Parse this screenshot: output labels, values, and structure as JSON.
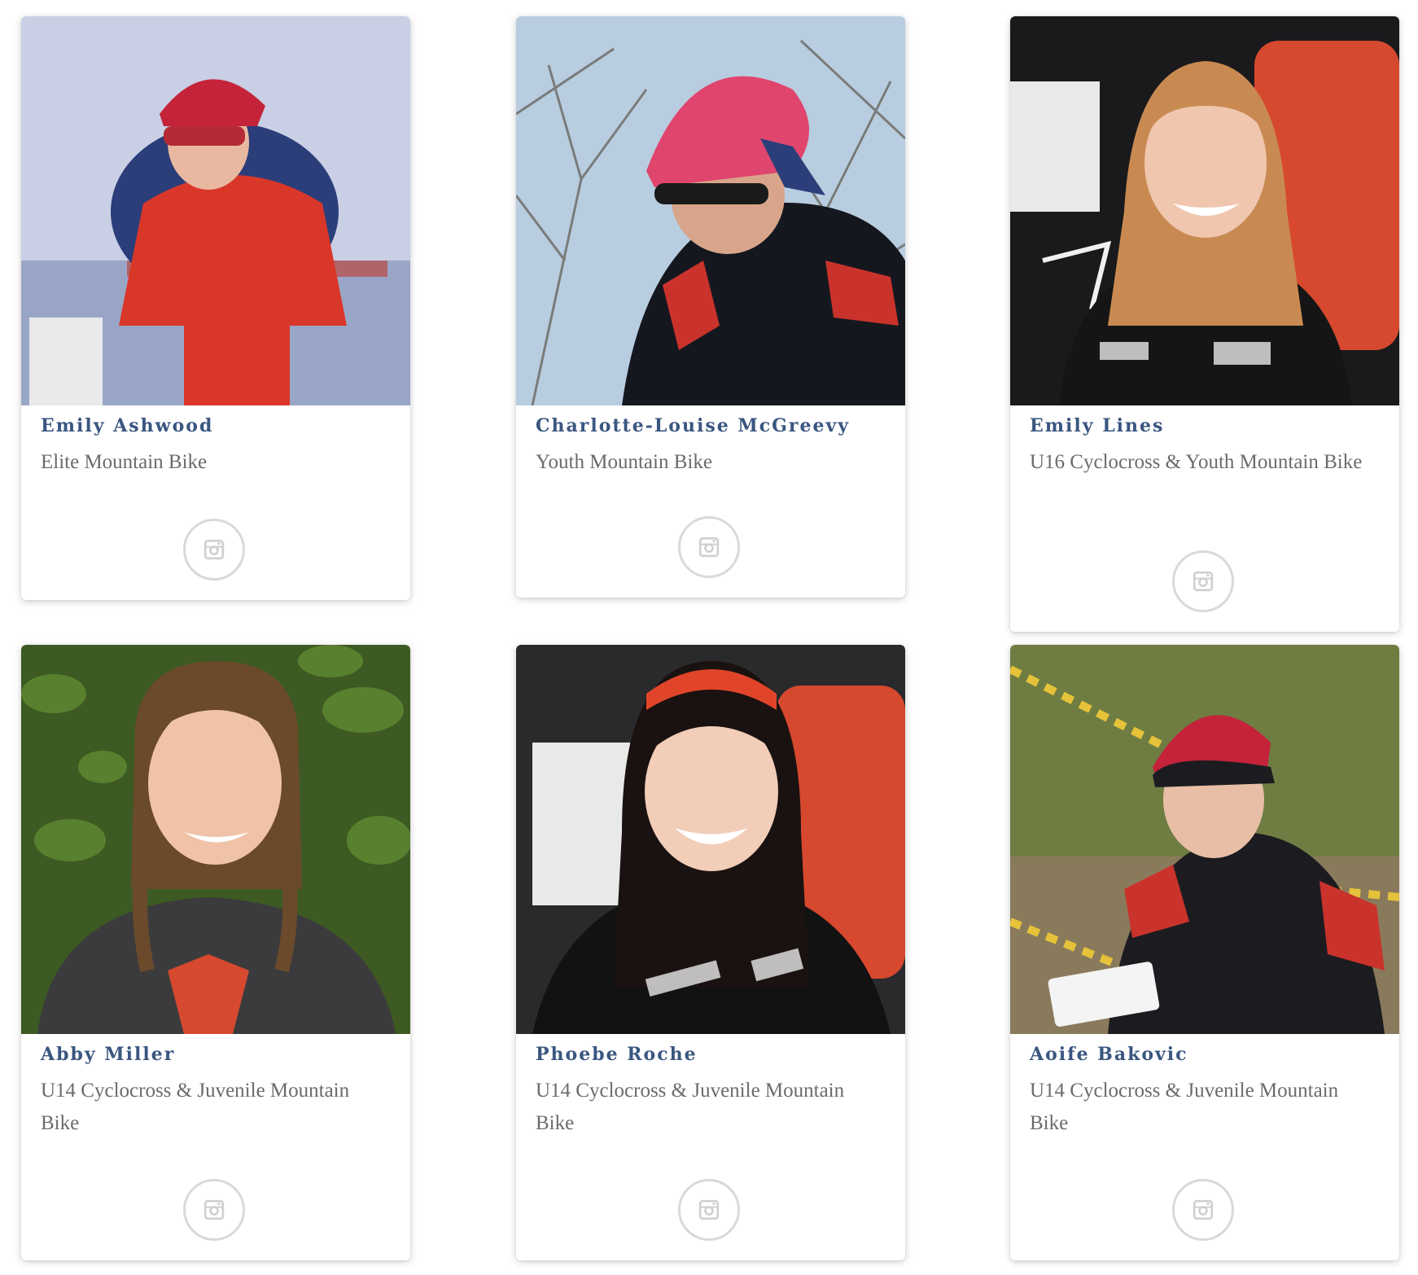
{
  "riders": [
    {
      "name": "Emily Ashwood",
      "role": "Elite Mountain Bike",
      "social_icon": "instagram-icon",
      "photo_palette": {
        "sky": "#c9cfe4",
        "kit": "#d9372a",
        "kit2": "#2b3e7a",
        "helmet": "#c4233a",
        "skin": "#e8b9a0",
        "bg": "#9aa6c7"
      }
    },
    {
      "name": "Charlotte-Louise McGreevy",
      "role": "Youth Mountain Bike",
      "social_icon": "instagram-icon",
      "photo_palette": {
        "sky": "#b9cde0",
        "kit": "#15171f",
        "kit2": "#c9332b",
        "helmet": "#e0456e",
        "skin": "#d8a58a",
        "bg": "#8a8b86"
      }
    },
    {
      "name": "Emily Lines",
      "role": "U16 Cyclocross & Youth Mountain Bike",
      "social_icon": "instagram-icon",
      "photo_palette": {
        "sky": "#1a1a1c",
        "kit": "#151515",
        "kit2": "#d6492f",
        "helmet": "#c98a52",
        "skin": "#f0c6ae",
        "bg": "#2a2a2c"
      }
    },
    {
      "name": "Abby Miller",
      "role": "U14 Cyclocross & Juvenile Mountain Bike",
      "social_icon": "instagram-icon",
      "photo_palette": {
        "sky": "#2f4a1c",
        "kit": "#3b3b3d",
        "kit2": "#d6492f",
        "helmet": "#6b4a2c",
        "skin": "#f0c3a8",
        "bg": "#3d5a22"
      }
    },
    {
      "name": "Phoebe Roche",
      "role": "U14 Cyclocross & Juvenile Mountain Bike",
      "social_icon": "instagram-icon",
      "photo_palette": {
        "sky": "#1e1e20",
        "kit": "#121212",
        "kit2": "#d6492f",
        "helmet": "#1a1210",
        "skin": "#f2cdb8",
        "bg": "#2a2a2c"
      }
    },
    {
      "name": "Aoife Bakovic",
      "role": "U14 Cyclocross & Juvenile Mountain Bike",
      "social_icon": "instagram-icon",
      "photo_palette": {
        "sky": "#7a8a4a",
        "kit": "#1c1c20",
        "kit2": "#c9332b",
        "helmet": "#c4233a",
        "skin": "#e8bfa6",
        "bg": "#6f7d43"
      }
    }
  ],
  "colors": {
    "name": "#3a5680",
    "role": "#6b6b6b",
    "icon_ring": "#d9d9d9"
  }
}
